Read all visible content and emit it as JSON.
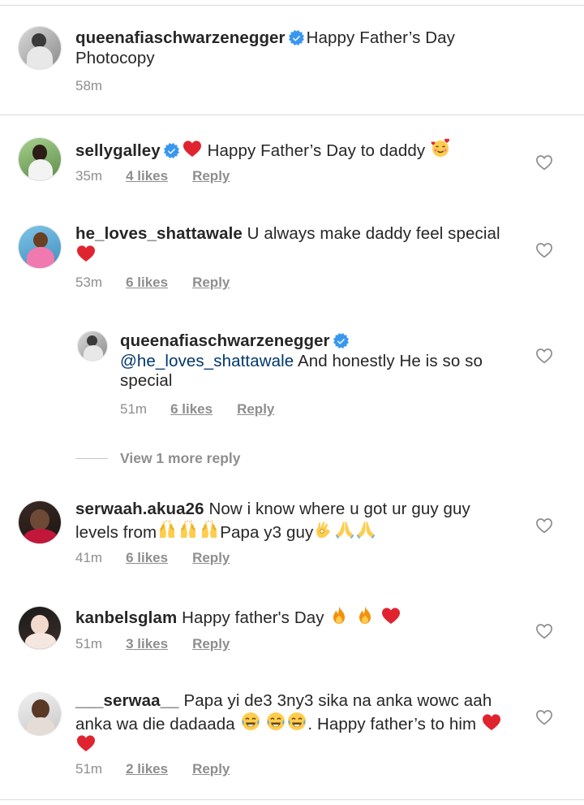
{
  "caption": {
    "username": "queenafiaschwarzenegger",
    "text": "Happy Father’s Day Photocopy",
    "time": "58m"
  },
  "comments": [
    {
      "username": "sellygalley",
      "verified": true,
      "text_pre": "",
      "text": "Happy Father’s Day to daddy",
      "time": "35m",
      "likes": "4 likes",
      "reply": "Reply"
    },
    {
      "username": "he_loves_shattawale",
      "text": "U always make daddy feel special",
      "time": "53m",
      "likes": "6 likes",
      "reply": "Reply"
    },
    {
      "username": "queenafiaschwarzenegger",
      "verified": true,
      "mention": "@he_loves_shattawale",
      "text": "And honestly He is so so special",
      "time": "51m",
      "likes": "6 likes",
      "reply": "Reply"
    },
    {
      "username": "serwaah.akua26",
      "text": "Now i know where u got ur guy guy levels from",
      "text_b": "Papa y3 guy",
      "time": "41m",
      "likes": "6 likes",
      "reply": "Reply"
    },
    {
      "username": "kanbelsglam",
      "text": "Happy father's Day",
      "time": "51m",
      "likes": "3 likes",
      "reply": "Reply"
    },
    {
      "username": "___serwaa__",
      "text": "Papa yi de3 3ny3 sika na anka wowc aah anka wa die dadaada",
      "text_b": ". Happy father’s to him",
      "time": "51m",
      "likes": "2 likes",
      "reply": "Reply"
    }
  ],
  "view_more": "View 1 more reply",
  "colors": {
    "verified": "#3897f0",
    "heart_red": "#ed4956",
    "muted": "#8e8e8e",
    "mention": "#00376b"
  }
}
